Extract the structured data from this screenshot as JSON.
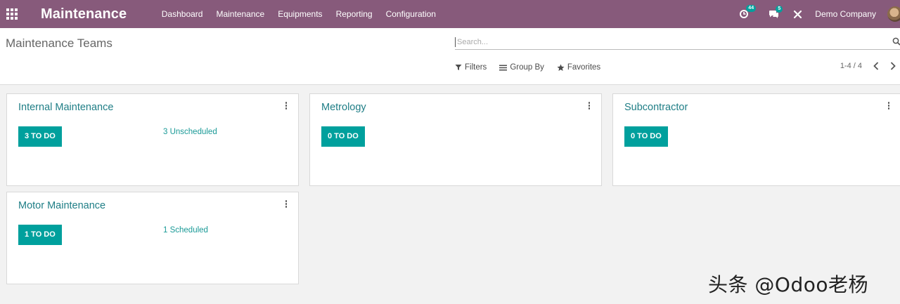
{
  "navbar": {
    "brand": "Maintenance",
    "menu": [
      "Dashboard",
      "Maintenance",
      "Equipments",
      "Reporting",
      "Configuration"
    ],
    "activity_count": "44",
    "message_count": "5",
    "company": "Demo Company"
  },
  "control_panel": {
    "title": "Maintenance Teams",
    "search_placeholder": "Search...",
    "filters_label": "Filters",
    "group_by_label": "Group By",
    "favorites_label": "Favorites",
    "pager": "1-4 / 4"
  },
  "teams": [
    {
      "name": "Internal Maintenance",
      "todo": "3 TO DO",
      "link": "3 Unscheduled"
    },
    {
      "name": "Metrology",
      "todo": "0 TO DO",
      "link": ""
    },
    {
      "name": "Subcontractor",
      "todo": "0 TO DO",
      "link": ""
    },
    {
      "name": "Motor Maintenance",
      "todo": "1 TO DO",
      "link": "1 Scheduled"
    }
  ],
  "watermark": "头条 @Odoo老杨",
  "colors": {
    "brand": "#875a7b",
    "accent": "#00a09d",
    "title": "#1f7e86"
  },
  "icons": [
    "apps-icon",
    "activity-icon",
    "chat-icon",
    "tools-icon",
    "search-icon",
    "filter-icon",
    "list-icon",
    "star-icon",
    "chevron-left-icon",
    "chevron-right-icon",
    "kebab-icon"
  ]
}
